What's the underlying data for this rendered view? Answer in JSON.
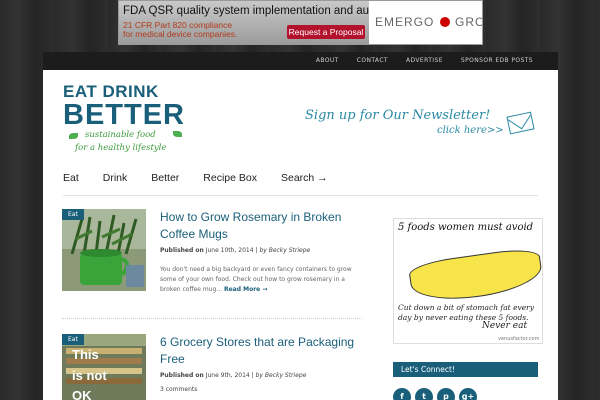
{
  "ad": {
    "headline": "FDA QSR quality system implementation and auditing",
    "subtext": "21 CFR Part 820 compliance for medical device companies.",
    "button": "Request a Proposal",
    "brand": "EMERGO",
    "brand_suffix": "GROUP"
  },
  "top_nav": [
    "ABOUT",
    "CONTACT",
    "ADVERTISE",
    "SPONSOR EDB POSTS"
  ],
  "logo": {
    "line1": "EAT DRINK",
    "line2": "BETTER",
    "tagline1": "sustainable food",
    "tagline2": "for a healthy lifestyle"
  },
  "newsletter": {
    "line1": "Sign up for Our Newsletter!",
    "line2": "click here>>"
  },
  "main_nav": [
    "Eat",
    "Drink",
    "Better",
    "Recipe Box",
    "Search →"
  ],
  "posts": [
    {
      "category": "Eat",
      "title": "How to Grow Rosemary in Broken Coffee Mugs",
      "published_label": "Published on",
      "date": "June 10th, 2014",
      "separator": "|",
      "author": "by Becky Striepe",
      "excerpt": "You don't need a big backyard or even fancy containers to grow some of your own food. Check out how to grow rosemary in a broken coffee mug...",
      "read_more": "Read More →"
    },
    {
      "category": "Eat",
      "title": "6 Grocery Stores that are Packaging Free",
      "published_label": "Published on",
      "date": "June 9th, 2014",
      "separator": "|",
      "author": "by Becky Striepe",
      "comments": "3 comments"
    }
  ],
  "sidebar": {
    "ad_top": "5 foods women must avoid",
    "ad_bottom": "Cut down a bit of stomach fat every day by never eating these 5 foods.",
    "ad_never": "Never eat",
    "ad_credit": "venusfactor.com",
    "connect": "Let's Connect!",
    "social_icons": [
      "facebook-icon",
      "twitter-icon",
      "pinterest-icon",
      "google-plus-icon"
    ]
  },
  "colors": {
    "brand": "#1a5f7a",
    "accent_green": "#3a9a3a",
    "background": "#2a2a2a"
  }
}
